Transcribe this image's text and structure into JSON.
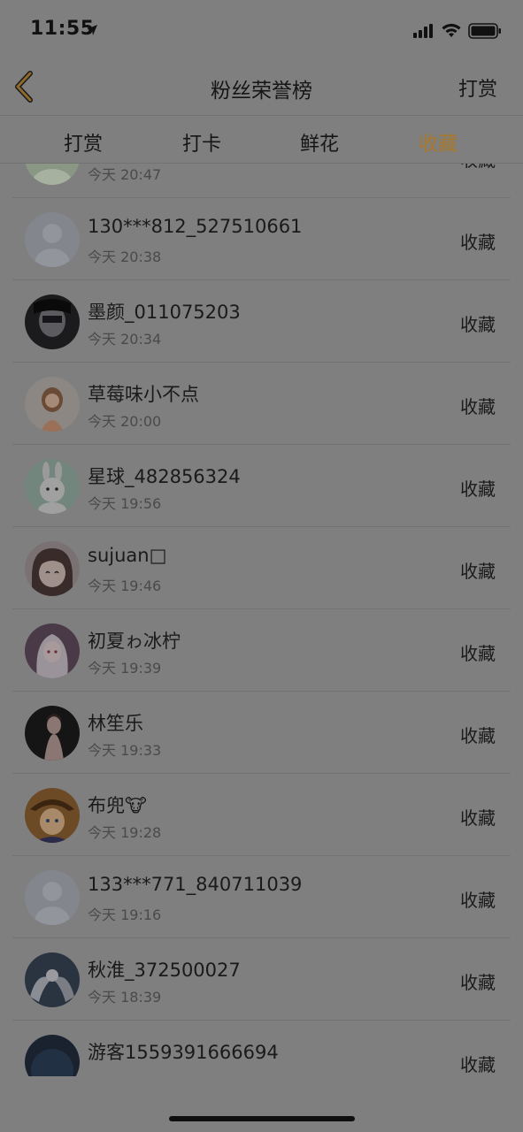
{
  "status_bar": {
    "time": "11:55"
  },
  "nav": {
    "title": "粉丝荣誉榜",
    "action_label": "打赏"
  },
  "tabs": [
    {
      "label": "打赏",
      "active": false
    },
    {
      "label": "打卡",
      "active": false
    },
    {
      "label": "鲜花",
      "active": false
    },
    {
      "label": "收藏",
      "active": true
    }
  ],
  "list": {
    "items": [
      {
        "name": "",
        "time": "今天 20:47",
        "action": "收藏",
        "avatar": "avatar-partial"
      },
      {
        "name": "130***812_527510661",
        "time": "今天 20:38",
        "action": "收藏",
        "avatar": "default-avatar"
      },
      {
        "name": "墨颜_011075203",
        "time": "今天 20:34",
        "action": "收藏",
        "avatar": "dark-anime-avatar"
      },
      {
        "name": "草莓味小不点",
        "time": "今天 20:00",
        "action": "收藏",
        "avatar": "girl-photo-avatar"
      },
      {
        "name": "星球_482856324",
        "time": "今天 19:56",
        "action": "收藏",
        "avatar": "bunny-avatar"
      },
      {
        "name": "sujuan□",
        "time": "今天 19:46",
        "action": "收藏",
        "avatar": "anime-girl-avatar"
      },
      {
        "name": "初夏ゎ冰柠",
        "time": "今天 19:39",
        "action": "收藏",
        "avatar": "anime-white-hair-avatar"
      },
      {
        "name": "林笙乐",
        "time": "今天 19:33",
        "action": "收藏",
        "avatar": "woman-photo-avatar"
      },
      {
        "name": "布兜🐮",
        "time": "今天 19:28",
        "action": "收藏",
        "avatar": "detective-avatar"
      },
      {
        "name": "133***771_840711039",
        "time": "今天 19:16",
        "action": "收藏",
        "avatar": "default-avatar"
      },
      {
        "name": "秋淮_372500027",
        "time": "今天 18:39",
        "action": "收藏",
        "avatar": "angel-avatar"
      },
      {
        "name": "游客1559391666694",
        "time": "",
        "action": "收藏",
        "avatar": "night-sky-avatar"
      }
    ]
  }
}
